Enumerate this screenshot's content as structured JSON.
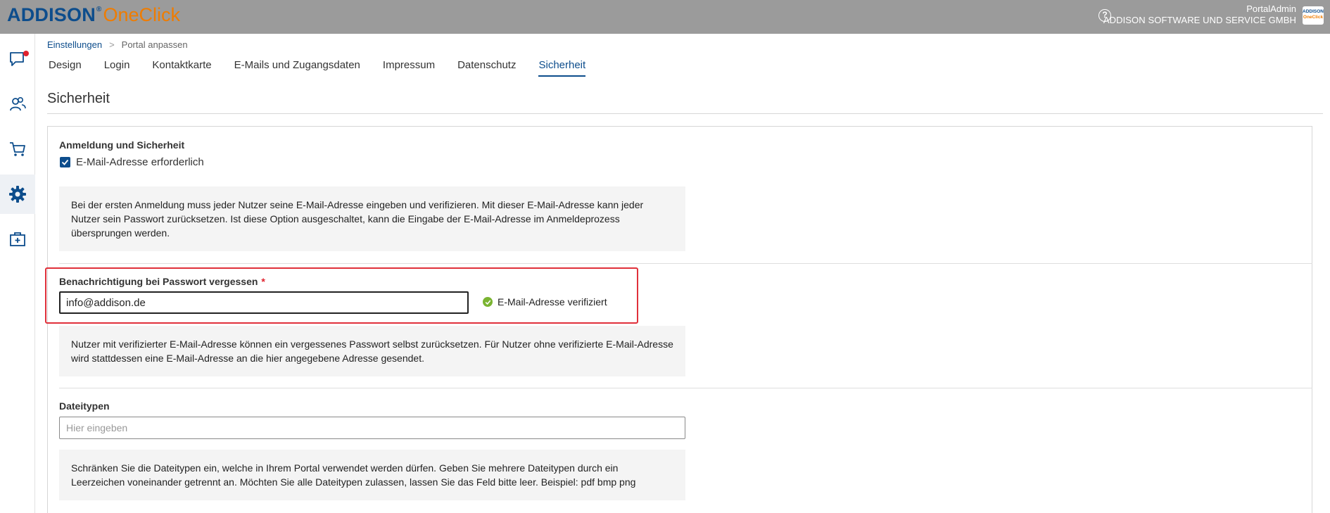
{
  "header": {
    "logo_primary": "ADDISON",
    "logo_registered": "®",
    "logo_secondary": "OneClick",
    "help_icon": "?",
    "user_name": "PortalAdmin",
    "company": "ADDISON SOFTWARE UND SERVICE GMBH",
    "user_logo_top": "ADDISON",
    "user_logo_bottom": "OneClick"
  },
  "sidebar": {
    "items": [
      {
        "icon": "chat-icon",
        "notification": true
      },
      {
        "icon": "users-icon"
      },
      {
        "icon": "cart-icon"
      },
      {
        "icon": "gear-icon",
        "active": true
      },
      {
        "icon": "medical-case-icon"
      }
    ]
  },
  "breadcrumb": {
    "parent": "Einstellungen",
    "separator": ">",
    "current": "Portal anpassen"
  },
  "tabs": [
    {
      "label": "Design"
    },
    {
      "label": "Login"
    },
    {
      "label": "Kontaktkarte"
    },
    {
      "label": "E-Mails und Zugangsdaten"
    },
    {
      "label": "Impressum"
    },
    {
      "label": "Datenschutz"
    },
    {
      "label": "Sicherheit",
      "active": true
    }
  ],
  "page_title": "Sicherheit",
  "login_section": {
    "title": "Anmeldung und Sicherheit",
    "checkbox_label": "E-Mail-Adresse erforderlich",
    "checkbox_checked": true,
    "info": "Bei der ersten Anmeldung muss jeder Nutzer seine E-Mail-Adresse eingeben und verifizieren. Mit dieser E-Mail-Adresse kann jeder Nutzer sein Passwort zurücksetzen. Ist diese Option ausgeschaltet, kann die Eingabe der E-Mail-Adresse im Anmeldeprozess übersprungen werden."
  },
  "password_section": {
    "title": "Benachrichtigung bei Passwort vergessen",
    "required_marker": "*",
    "email_value": "info@addison.de",
    "verified_label": "E-Mail-Adresse verifiziert",
    "info": "Nutzer mit verifizierter E-Mail-Adresse können ein vergessenes Passwort selbst zurücksetzen. Für Nutzer ohne verifizierte E-Mail-Adresse wird stattdessen eine E-Mail-Adresse an die hier angegebene Adresse gesendet."
  },
  "filetypes_section": {
    "title": "Dateitypen",
    "placeholder": "Hier eingeben",
    "info": "Schränken Sie die Dateitypen ein, welche in Ihrem Portal verwendet werden dürfen. Geben Sie mehrere Dateitypen durch ein Leerzeichen voneinander getrennt an. Möchten Sie alle Dateitypen zulassen, lassen Sie das Feld bitte leer. Beispiel: pdf bmp png"
  },
  "colors": {
    "brand_blue": "#0d4d8c",
    "brand_orange": "#ef7c00",
    "header_gray": "#9b9b9b",
    "highlight_red": "#e0303a",
    "verified_green": "#7ab431"
  }
}
